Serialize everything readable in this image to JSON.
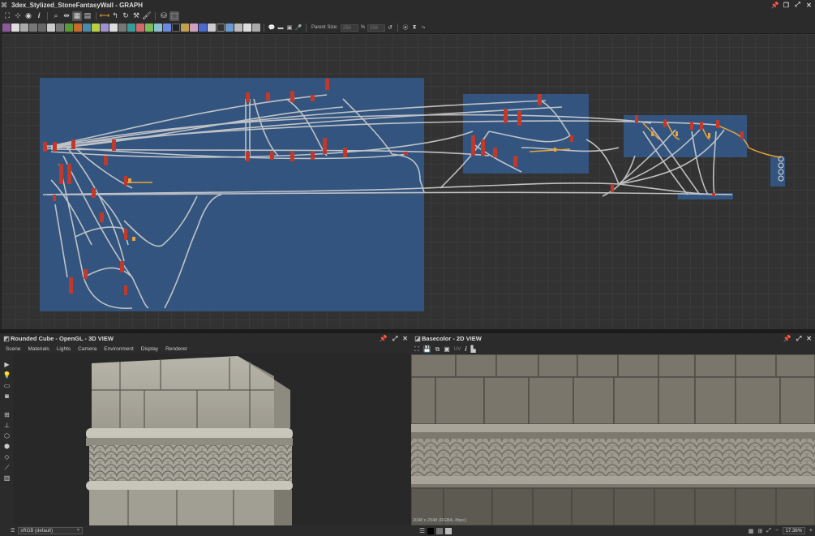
{
  "window": {
    "title": "3dex_Stylized_StoneFantasyWall - GRAPH"
  },
  "toolbar2": {
    "parent_size_label": "Parent Size:",
    "parent_size_a": "256",
    "parent_size_b": "256",
    "link_symbol": "%"
  },
  "graph_pane": {
    "frames": 3
  },
  "view3d": {
    "title": "Rounded Cube - OpenGL - 3D VIEW",
    "menu": [
      "Scene",
      "Materials",
      "Lights",
      "Camera",
      "Environment",
      "Display",
      "Renderer"
    ],
    "colorspace": "sRGB (default)"
  },
  "view2d": {
    "title": "Basecolor - 2D VIEW",
    "info": "2048 x 2048 (RGBA, 8bpc)",
    "zoom": "17.36%",
    "channel": "UV"
  },
  "icons": [
    "window-icon",
    "pin-icon",
    "maximize-icon",
    "close-icon"
  ],
  "colors": {
    "frame": "#325a8c",
    "wire": "#d0d0d0",
    "node": "#c0392b",
    "accent": "#e8a33a"
  }
}
